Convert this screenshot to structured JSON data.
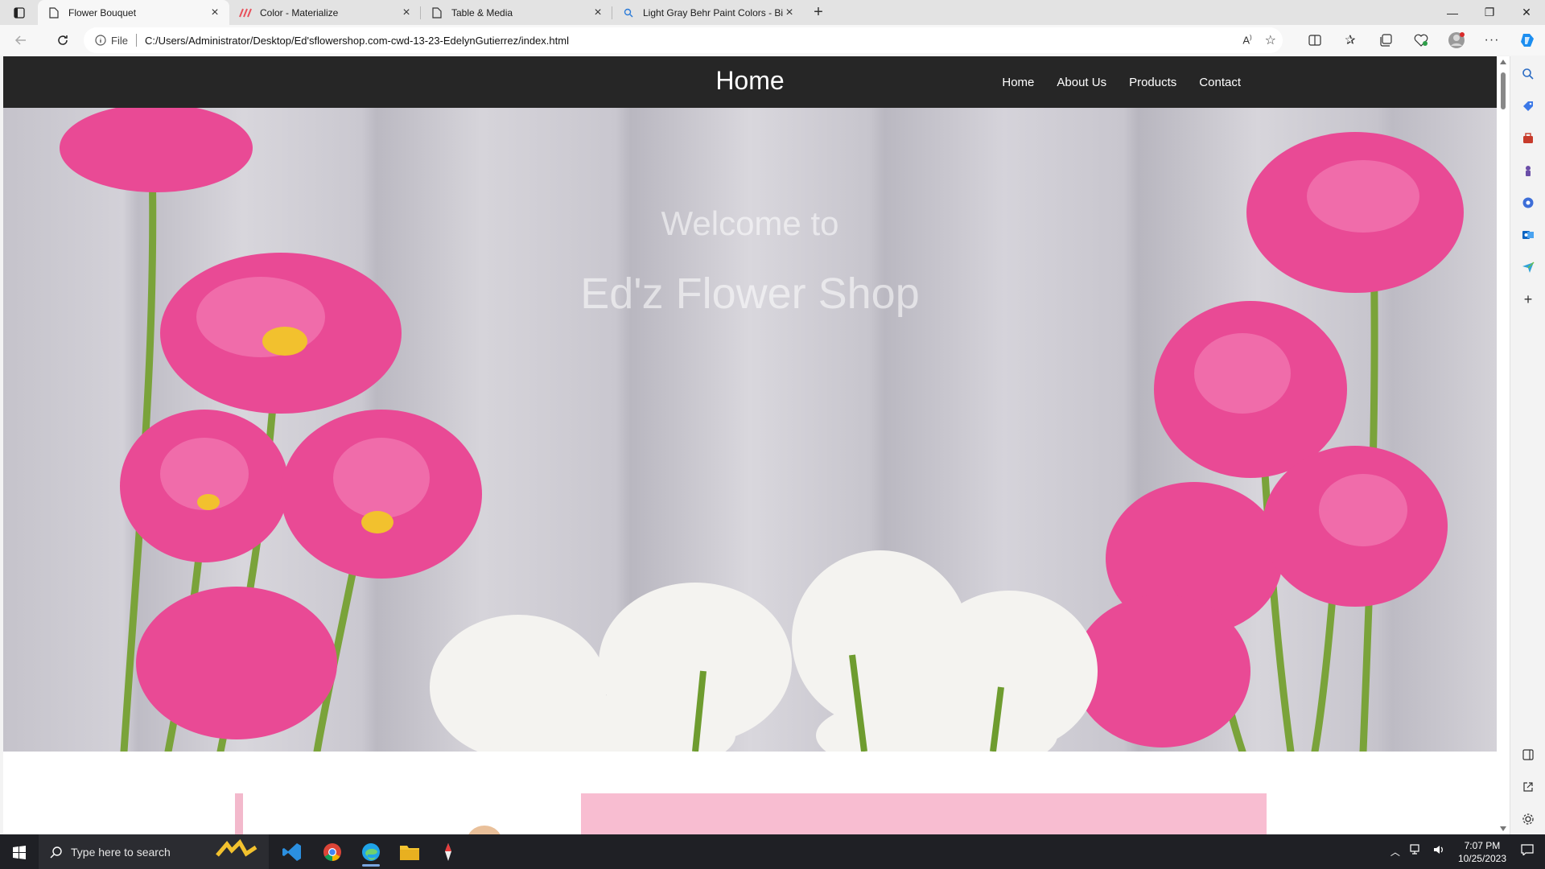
{
  "browser": {
    "tabs": [
      {
        "title": "Flower Bouquet",
        "active": true,
        "icon": "page-icon"
      },
      {
        "title": "Color - Materialize",
        "active": false,
        "icon": "materialize-icon"
      },
      {
        "title": "Table & Media",
        "active": false,
        "icon": "page-icon"
      },
      {
        "title": "Light Gray Behr Paint Colors - Bin",
        "active": false,
        "icon": "search-icon"
      }
    ],
    "address": {
      "scheme_label": "File",
      "url": "C:/Users/Administrator/Desktop/Ed'sflowershop.com-cwd-13-23-EdelynGutierrez/index.html"
    }
  },
  "site": {
    "brand": "Home",
    "nav": [
      {
        "label": "Home"
      },
      {
        "label": "About Us"
      },
      {
        "label": "Products"
      },
      {
        "label": "Contact"
      }
    ],
    "hero": {
      "line1": "Welcome to",
      "line2": "Ed'z Flower Shop"
    },
    "colors": {
      "nav_bg": "#262626",
      "accent_pink": "#f8bdd1",
      "tulip_pink": "#e94a95"
    }
  },
  "taskbar": {
    "search_placeholder": "Type here to search",
    "time": "7:07 PM",
    "date": "10/25/2023"
  }
}
